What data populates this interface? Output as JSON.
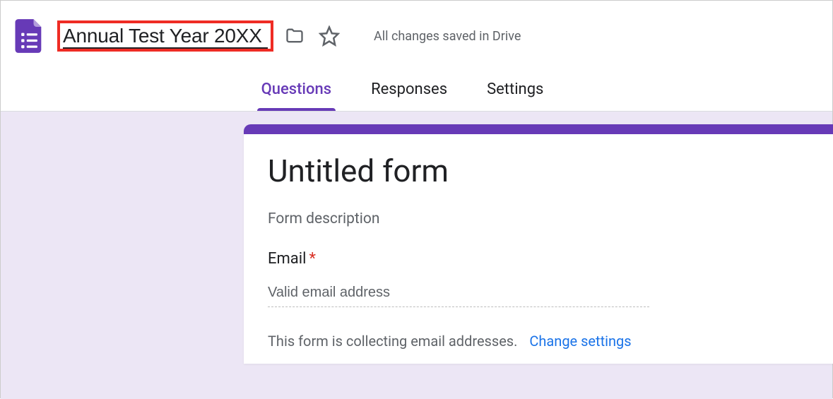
{
  "header": {
    "title": "Annual Test Year 20XX",
    "saved_text": "All changes saved in Drive"
  },
  "tabs": {
    "questions": "Questions",
    "responses": "Responses",
    "settings": "Settings"
  },
  "form": {
    "title": "Untitled form",
    "description": "Form description",
    "email_label": "Email",
    "required_mark": "*",
    "email_placeholder": "Valid email address",
    "collecting_text": "This form is collecting email addresses.",
    "change_link": "Change settings"
  },
  "colors": {
    "accent": "#673ab7",
    "highlight_box": "#ef2c24",
    "link": "#1a73e8"
  }
}
